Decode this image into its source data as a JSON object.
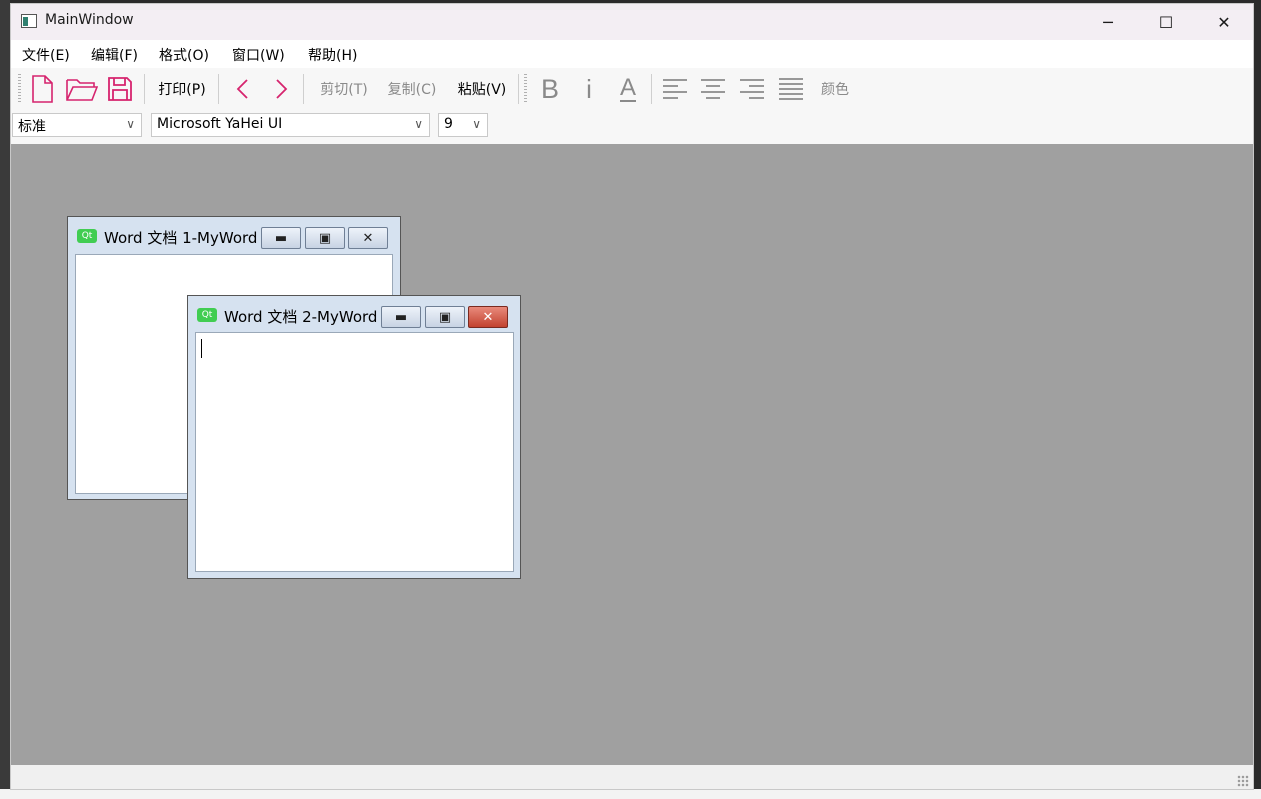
{
  "window": {
    "title": "MainWindow"
  },
  "title_controls": {
    "minimize": "─",
    "maximize": "☐",
    "close": "✕"
  },
  "menu": [
    "文件(E)",
    "编辑(F)",
    "格式(O)",
    "窗口(W)",
    "帮助(H)"
  ],
  "toolbar": {
    "print": "打印(P)",
    "cut": "剪切(T)",
    "copy": "复制(C)",
    "paste": "粘贴(V)",
    "bold": "B",
    "italic": "i",
    "underline": "A",
    "color": "颜色"
  },
  "format": {
    "style": "标准",
    "font": "Microsoft YaHei UI",
    "size": "9"
  },
  "subwindows": [
    {
      "title": "Word 文档 1-MyWord"
    },
    {
      "title": "Word 文档 2-MyWord"
    }
  ],
  "colors": {
    "accent": "#d6246e",
    "mdi_bg": "#a0a0a0",
    "active_close": "#c2422f"
  },
  "icons": [
    "new-file-icon",
    "open-folder-icon",
    "save-icon",
    "back-icon",
    "forward-icon",
    "align-left-icon",
    "align-center-icon",
    "align-right-icon",
    "justify-icon",
    "qt-icon"
  ]
}
